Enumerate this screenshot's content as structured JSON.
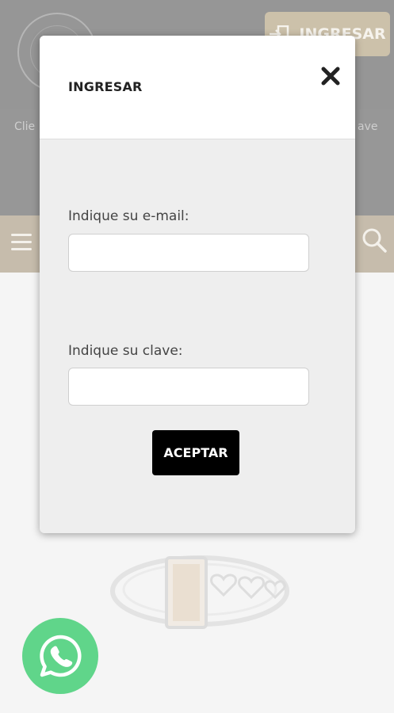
{
  "header": {
    "login_button_label": "INGRESAR",
    "subnav_left_text": "Clie",
    "subnav_right_text": "ave"
  },
  "modal": {
    "title": "INGRESAR",
    "email_label": "Indique su e-mail:",
    "email_value": "",
    "password_label": "Indique su clave:",
    "password_value": "",
    "accept_label": "ACEPTAR"
  },
  "icons": {
    "close": "close-icon",
    "menu": "hamburger-menu-icon",
    "search": "search-icon",
    "login": "sign-in-icon",
    "whatsapp": "whatsapp-icon"
  },
  "colors": {
    "brand_gold": "#b0a38c",
    "whatsapp_green": "#23c55e",
    "accept_button": "#000000"
  }
}
